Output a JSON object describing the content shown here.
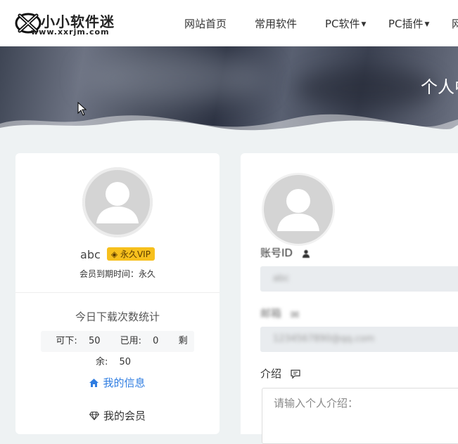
{
  "header": {
    "logo_title": "小小软件迷",
    "logo_url": "www.xxrjm.com",
    "nav": [
      {
        "label": "网站首页",
        "caret": false
      },
      {
        "label": "常用软件",
        "caret": false
      },
      {
        "label": "PC软件",
        "caret": true
      },
      {
        "label": "PC插件",
        "caret": true
      },
      {
        "label": "网",
        "caret": false
      }
    ]
  },
  "banner": {
    "title": "个人中"
  },
  "profile": {
    "username": "abc",
    "vip_badge": "永久VIP",
    "expire_text": "会员到期时间：永久",
    "stats_title": "今日下载次数统计",
    "stats": [
      {
        "label": "可下:",
        "value": "50"
      },
      {
        "label": "已用:",
        "value": "0"
      },
      {
        "label": "剩余:",
        "value": "50"
      }
    ],
    "menu": {
      "my_info": "我的信息",
      "my_vip": "我的会员"
    }
  },
  "form": {
    "account_label": "账号ID",
    "account_value": "abc",
    "email_label": "邮箱",
    "email_value": "1234567890@qq.com",
    "intro_label": "介绍",
    "intro_placeholder": "请输入个人介绍："
  },
  "colors": {
    "accent": "#2f7de1",
    "vip": "#f7c01d",
    "page_bg": "#eef2f3"
  }
}
